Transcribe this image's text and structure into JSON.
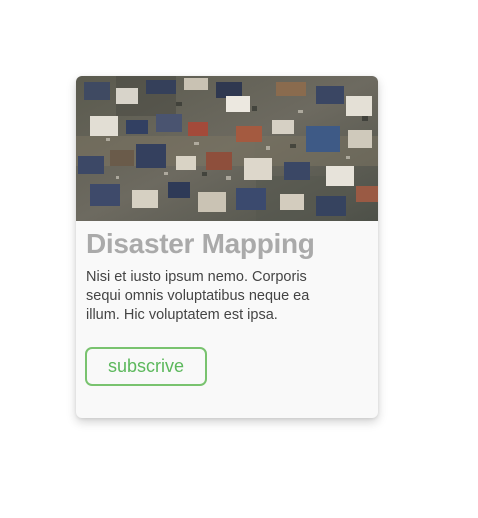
{
  "card": {
    "image_subject": "aerial-disaster-photo",
    "title": "Disaster Mapping",
    "text": "Nisi et iusto ipsum nemo. Corporis sequi omnis voluptatibus neque ea illum. Hic voluptatem est ipsa.",
    "button_label": "subscrive"
  },
  "colors": {
    "button_accent": "#79c36f",
    "button_text": "#5cb85c",
    "title": "#aaaaaa",
    "body_text": "#444444",
    "card_background": "#f9f9f9"
  }
}
